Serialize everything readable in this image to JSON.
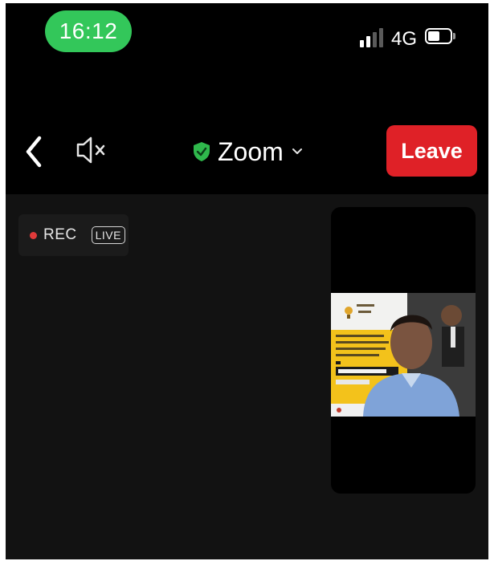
{
  "status_bar": {
    "time": "16:12",
    "network": "4G",
    "icons": [
      "signal-bars-icon",
      "battery-icon"
    ]
  },
  "toolbar": {
    "meeting_title": "Zoom",
    "leave_label": "Leave",
    "icons": [
      "back-chevron-icon",
      "speaker-muted-icon",
      "encryption-shield-icon",
      "chevron-down-icon"
    ]
  },
  "video_area": {
    "recording_label": "REC",
    "live_label": "LIVE"
  },
  "colors": {
    "time_pill": "#33c75a",
    "leave_button": "#df2127",
    "shield": "#2fb84c",
    "recording_dot": "#e03a3a",
    "background": "#000000",
    "video_background": "#121212"
  }
}
